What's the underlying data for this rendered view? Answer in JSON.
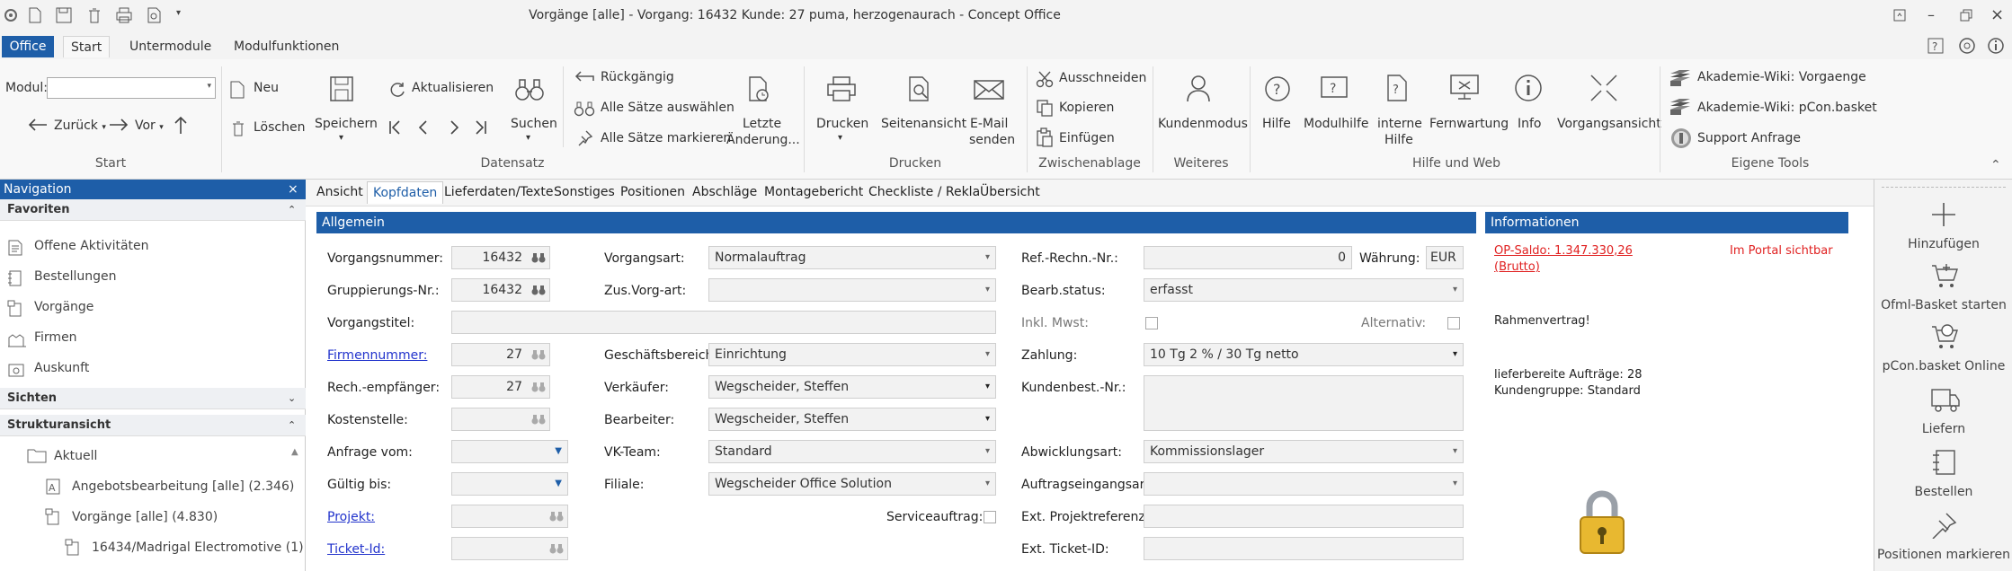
{
  "window": {
    "title": "Vorgänge [alle] - Vorgang: 16432 Kunde: 27 puma, herzogenaurach - Concept Office"
  },
  "tabs": [
    {
      "label": "Office"
    },
    {
      "label": "Start"
    },
    {
      "label": "Untermodule"
    },
    {
      "label": "Modulfunktionen"
    }
  ],
  "ribbon": {
    "start": {
      "modul_label": "Modul:",
      "zurueck": "Zurück",
      "vor": "Vor",
      "group": "Start"
    },
    "datensatz": {
      "neu": "Neu",
      "loeschen": "Löschen",
      "speichern": "Speichern",
      "aktualisieren": "Aktualisieren",
      "suchen": "Suchen",
      "rueckgaengig": "Rückgängig",
      "alle_auswaehlen": "Alle Sätze auswählen",
      "alle_markieren": "Alle Sätze markieren",
      "letzte_aenderung_1": "Letzte",
      "letzte_aenderung_2": "Änderung...",
      "group": "Datensatz"
    },
    "drucken": {
      "drucken": "Drucken",
      "seitenansicht": "Seitenansicht",
      "email_1": "E-Mail",
      "email_2": "senden",
      "group": "Drucken"
    },
    "zwischenablage": {
      "ausschneiden": "Ausschneiden",
      "kopieren": "Kopieren",
      "einfuegen": "Einfügen",
      "group": "Zwischenablage"
    },
    "weiteres": {
      "kundenmodus": "Kundenmodus",
      "group": "Weiteres"
    },
    "hilfe": {
      "hilfe": "Hilfe",
      "modulhilfe": "Modulhilfe",
      "interne_1": "interne",
      "interne_2": "Hilfe",
      "fernwartung": "Fernwartung",
      "info": "Info",
      "vorgangsansicht": "Vorgangsansicht",
      "group": "Hilfe und Web"
    },
    "eigene": {
      "wiki_vorgaenge": "Akademie-Wiki: Vorgaenge",
      "wiki_pcon": "Akademie-Wiki: pCon.basket",
      "support": "Support Anfrage",
      "group": "Eigene Tools"
    }
  },
  "nav": {
    "title": "Navigation",
    "favoriten": "Favoriten",
    "fav_items": [
      {
        "label": "Offene Aktivitäten"
      },
      {
        "label": "Bestellungen"
      },
      {
        "label": "Vorgänge"
      },
      {
        "label": "Firmen"
      },
      {
        "label": "Auskunft"
      }
    ],
    "sichten": "Sichten",
    "struktur": "Strukturansicht",
    "tree": [
      {
        "label": "Aktuell"
      },
      {
        "label": "Angebotsbearbeitung [alle] (2.346)"
      },
      {
        "label": "Vorgänge [alle] (4.830)"
      },
      {
        "label": "16434/Madrigal Electromotive (1)"
      }
    ]
  },
  "content_tabs": [
    {
      "label": "Ansicht"
    },
    {
      "label": "Kopfdaten"
    },
    {
      "label": "Lieferdaten/Texte"
    },
    {
      "label": "Sonstiges"
    },
    {
      "label": "Positionen"
    },
    {
      "label": "Abschläge"
    },
    {
      "label": "Montagebericht"
    },
    {
      "label": "Checkliste / Rekla"
    },
    {
      "label": "Übersicht"
    }
  ],
  "allgemein": {
    "title": "Allgemein",
    "vorgangsnummer": {
      "label": "Vorgangsnummer:",
      "value": "16432"
    },
    "gruppierungsnr": {
      "label": "Gruppierungs-Nr.:",
      "value": "16432"
    },
    "vorgangstitel": {
      "label": "Vorgangstitel:",
      "value": ""
    },
    "firmennummer": {
      "label": "Firmennummer:",
      "value": "27"
    },
    "rechempfaenger": {
      "label": "Rech.-empfänger:",
      "value": "27"
    },
    "kostenstelle": {
      "label": "Kostenstelle:",
      "value": ""
    },
    "anfrage_vom": {
      "label": "Anfrage vom:",
      "value": ""
    },
    "gueltig_bis": {
      "label": "Gültig bis:",
      "value": ""
    },
    "projekt": {
      "label": "Projekt:",
      "value": ""
    },
    "ticket_id": {
      "label": "Ticket-Id:",
      "value": ""
    },
    "vorgangsart": {
      "label": "Vorgangsart:",
      "value": "Normalauftrag"
    },
    "zus_vorg_art": {
      "label": "Zus.Vorg-art:",
      "value": ""
    },
    "geschaeftsbereich": {
      "label": "Geschäftsbereich:",
      "value": "Einrichtung"
    },
    "verkaeufer": {
      "label": "Verkäufer:",
      "value": "Wegscheider, Steffen"
    },
    "bearbeiter": {
      "label": "Bearbeiter:",
      "value": "Wegscheider, Steffen"
    },
    "vk_team": {
      "label": "VK-Team:",
      "value": "Standard"
    },
    "filiale": {
      "label": "Filiale:",
      "value": "Wegscheider Office Solution"
    },
    "serviceauftrag": {
      "label": "Serviceauftrag:"
    },
    "ref_rechn_nr": {
      "label": "Ref.-Rechn.-Nr.:",
      "value": "0"
    },
    "waehrung": {
      "label": "Währung:",
      "value": "EUR"
    },
    "bearb_status": {
      "label": "Bearb.status:",
      "value": "erfasst"
    },
    "inkl_mwst": {
      "label": "Inkl. Mwst:"
    },
    "alternativ": {
      "label": "Alternativ:"
    },
    "zahlung": {
      "label": "Zahlung:",
      "value": "10 Tg 2 % / 30 Tg netto"
    },
    "kundenbest_nr": {
      "label": "Kundenbest.-Nr.:",
      "value": ""
    },
    "abwicklungsart": {
      "label": "Abwicklungsart:",
      "value": "Kommissionslager"
    },
    "auftragseingangsart": {
      "label": "Auftragseingangsart:",
      "value": ""
    },
    "ext_projektreferenz": {
      "label": "Ext. Projektreferenz:",
      "value": ""
    },
    "ext_ticket_id": {
      "label": "Ext. Ticket-ID:",
      "value": ""
    }
  },
  "info": {
    "title": "Informationen",
    "op_saldo_1": "OP-Saldo: 1.347.330,26",
    "op_saldo_2": "(Brutto)",
    "portal": "Im Portal sichtbar",
    "rahmenvertrag": "Rahmenvertrag!",
    "lieferbereite": "lieferbereite Aufträge: 28",
    "kundengruppe": "Kundengruppe: Standard"
  },
  "right": {
    "hinzufuegen": "Hinzufügen",
    "ofml": "Ofml-Basket starten",
    "pcon": "pCon.basket Online",
    "liefern": "Liefern",
    "bestellen": "Bestellen",
    "positionen": "Positionen markieren"
  },
  "colors": {
    "accent": "#1e5ea8",
    "link": "#2233cc",
    "warning": "#e02020"
  }
}
